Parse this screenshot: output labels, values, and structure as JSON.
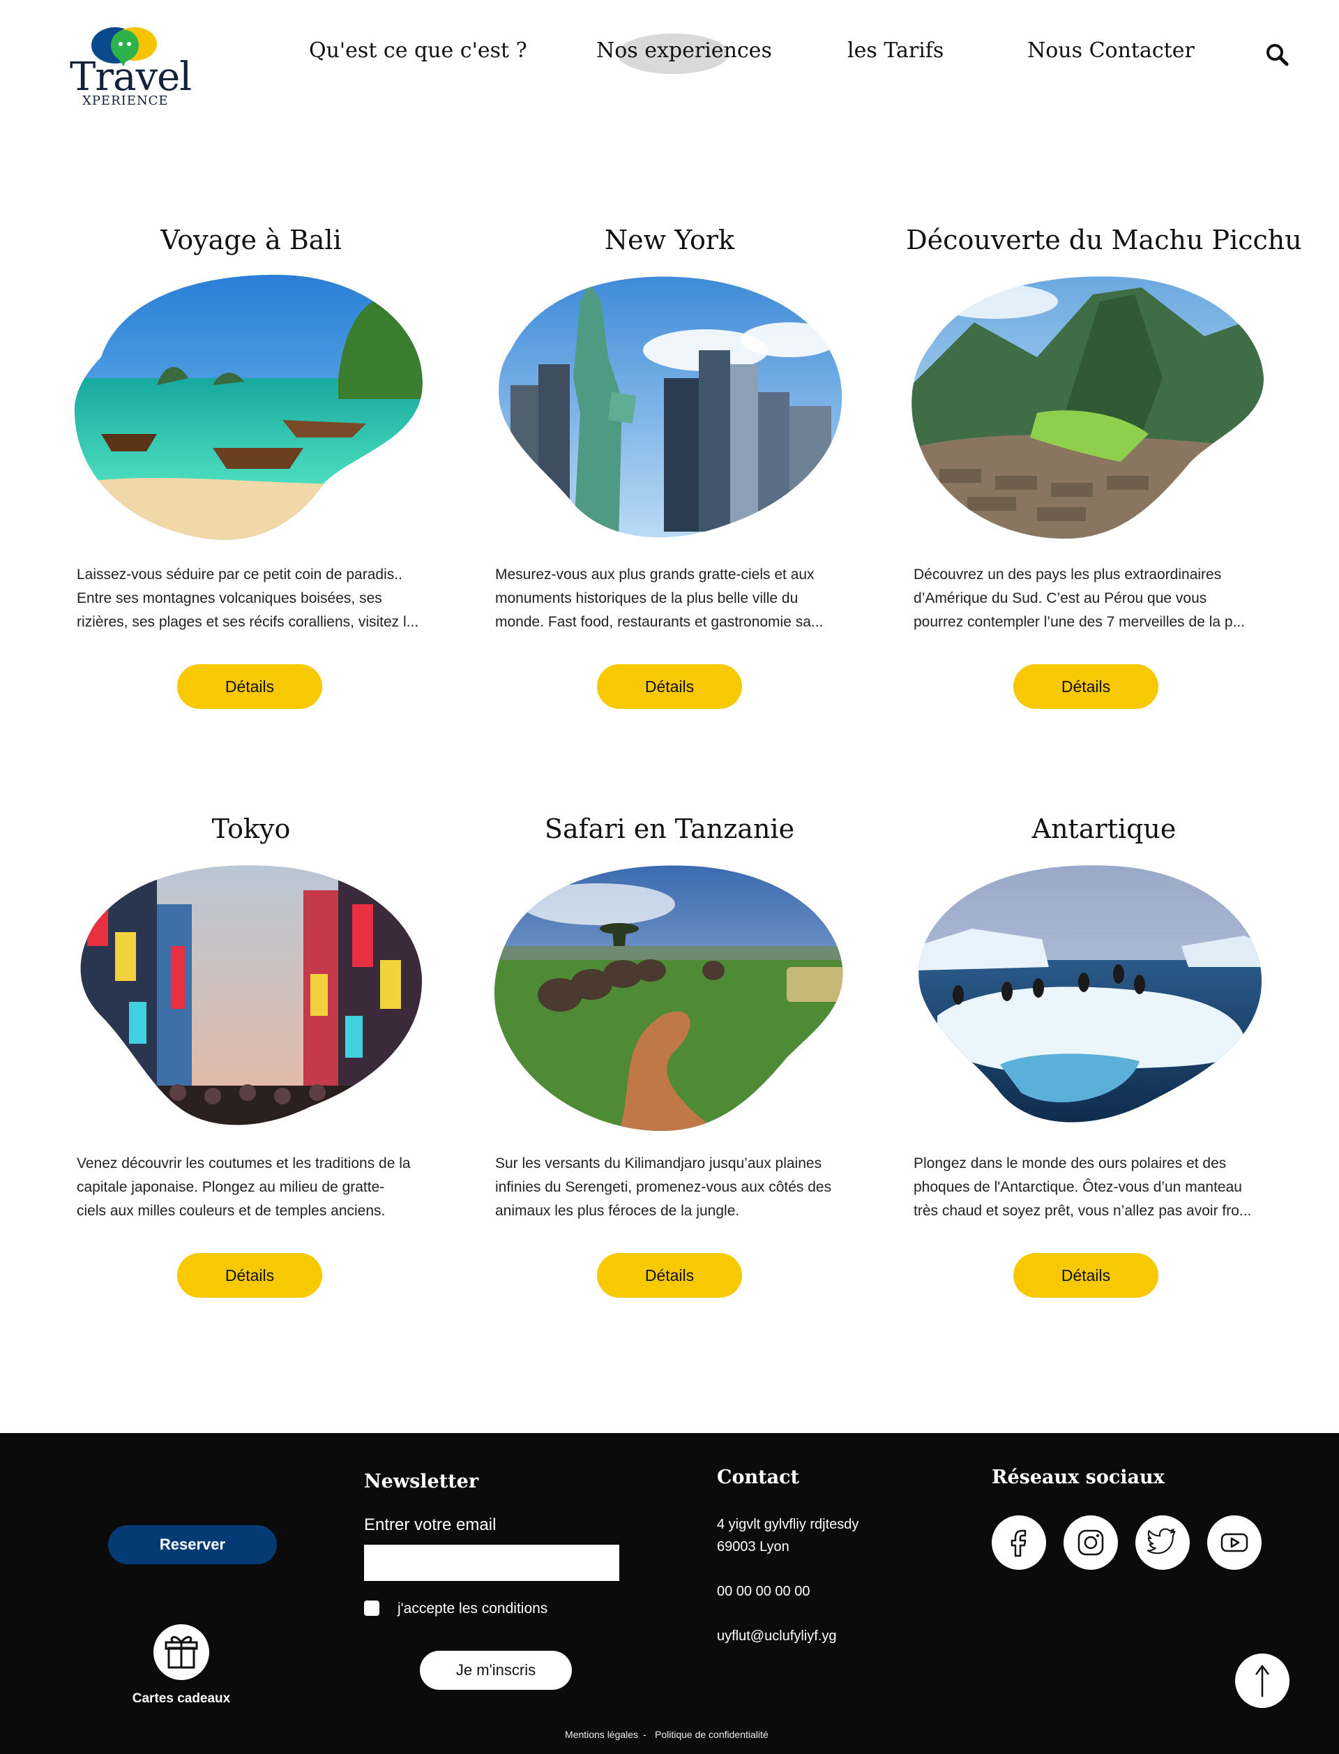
{
  "header": {
    "logo_text": "Travel",
    "logo_sub": "XPERIENCE",
    "nav": [
      {
        "label": "Qu'est ce que c'est ?"
      },
      {
        "label": "Nos experiences"
      },
      {
        "label": "les Tarifs"
      },
      {
        "label": "Nous Contacter"
      }
    ],
    "search_icon": "search-icon"
  },
  "cards": [
    {
      "title": "Voyage à Bali",
      "description": [
        "Laissez-vous séduire par ce petit coin de paradis..",
        "Entre ses montagnes volcaniques boisées, ses",
        "rizières, ses plages et ses récifs coralliens, visitez l..."
      ],
      "button": "Détails"
    },
    {
      "title": "New York",
      "description": [
        "Mesurez-vous aux plus grands gratte-ciels et aux",
        "monuments historiques de la plus belle ville du",
        "monde. Fast food, restaurants et gastronomie sa..."
      ],
      "button": "Détails"
    },
    {
      "title": "Découverte du Machu Picchu",
      "description": [
        "Découvrez un des pays les plus extraordinaires",
        "d’Amérique du Sud. C’est au Pérou que vous",
        "pourrez contempler l’une des 7 merveilles de la p..."
      ],
      "button": "Détails"
    },
    {
      "title": "Tokyo",
      "description": [
        "Venez découvrir les coutumes et les traditions de la",
        "capitale japonaise. Plongez au milieu de gratte-",
        "ciels aux milles couleurs et de temples anciens."
      ],
      "button": "Détails"
    },
    {
      "title": "Safari en Tanzanie",
      "description": [
        "Sur les versants du Kilimandjaro jusqu’aux plaines",
        "infinies du Serengeti, promenez-vous aux côtés des",
        "animaux les plus féroces de la jungle."
      ],
      "button": "Détails"
    },
    {
      "title": "Antartique",
      "description": [
        "Plongez dans le monde des ours polaires et des",
        "phoques de l'Antarctique. Ôtez-vous d’un manteau",
        "très chaud et soyez prêt, vous n’allez pas avoir fro..."
      ],
      "button": "Détails"
    }
  ],
  "footer": {
    "reserve_button": "Reserver",
    "gift_label": "Cartes cadeaux",
    "newsletter": {
      "heading": "Newsletter",
      "email_label": "Entrer votre email",
      "email_value": "",
      "checkbox_label": "j'accepte les conditions",
      "subscribe_button": "Je m'inscris"
    },
    "contact": {
      "heading": "Contact",
      "address_line1": "4 yigvlt gylvfliy rdjtesdy",
      "address_line2": "69003 Lyon",
      "phone": "00 00 00 00 00",
      "email": "uyflut@uclufyliyf.yg"
    },
    "social": {
      "heading": "Réseaux sociaux",
      "icons": [
        "facebook-icon",
        "instagram-icon",
        "twitter-icon",
        "youtube-icon"
      ]
    },
    "legal": {
      "mentions": "Mentions légales",
      "separator": "-",
      "privacy": "Politique de confidentialité"
    }
  },
  "colors": {
    "accent_yellow": "#f8c800",
    "reserve_blue": "#053b75",
    "footer_bg": "#0b0b0b"
  }
}
